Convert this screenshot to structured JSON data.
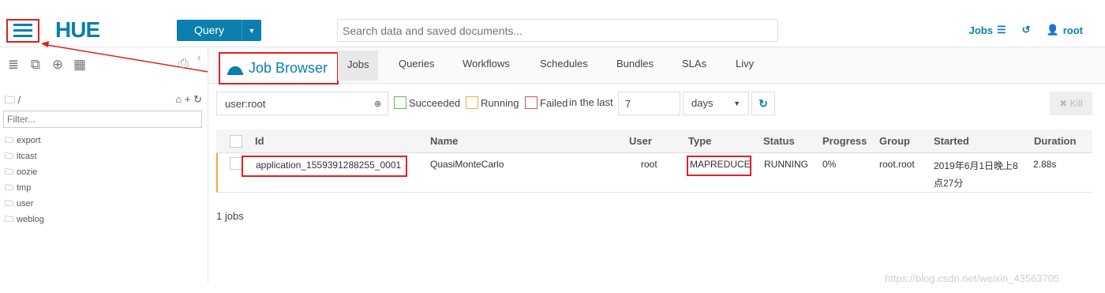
{
  "header": {
    "logo": "HUE",
    "query_label": "Query",
    "search_placeholder": "Search data and saved documents...",
    "jobs_label": "Jobs",
    "user_label": "root"
  },
  "left": {
    "path": "/",
    "filter_placeholder": "Filter...",
    "folders": [
      "export",
      "itcast",
      "oozie",
      "tmp",
      "user",
      "weblog"
    ]
  },
  "nav": {
    "brand": "Job Browser",
    "tabs": [
      "Jobs",
      "Queries",
      "Workflows",
      "Schedules",
      "Bundles",
      "SLAs",
      "Livy"
    ]
  },
  "filters": {
    "user": "user:root",
    "succeeded": "Succeeded",
    "running": "Running",
    "failed": "Failed",
    "in_last": "in the last",
    "number": "7",
    "unit": "days",
    "kill": "Kill"
  },
  "table": {
    "headers": [
      "Id",
      "Name",
      "User",
      "Type",
      "Status",
      "Progress",
      "Group",
      "Started",
      "Duration"
    ],
    "rows": [
      {
        "id": "application_1559391288255_0001",
        "name": "QuasiMonteCarlo",
        "user": "root",
        "type": "MAPREDUCE",
        "status": "RUNNING",
        "progress": "0%",
        "group": "root.root",
        "started_1": "2019年6月1日晚上8",
        "started_2": "点27分",
        "duration": "2.88s"
      }
    ]
  },
  "jobs_count": "1 jobs",
  "watermark": "https://blog.csdn.net/weixin_43563705",
  "colors": {
    "accent": "#0b7fad",
    "annotation_red": "#e02020",
    "succeeded": "#5cb85c",
    "running": "#f0ad4e",
    "failed": "#d9534f"
  }
}
